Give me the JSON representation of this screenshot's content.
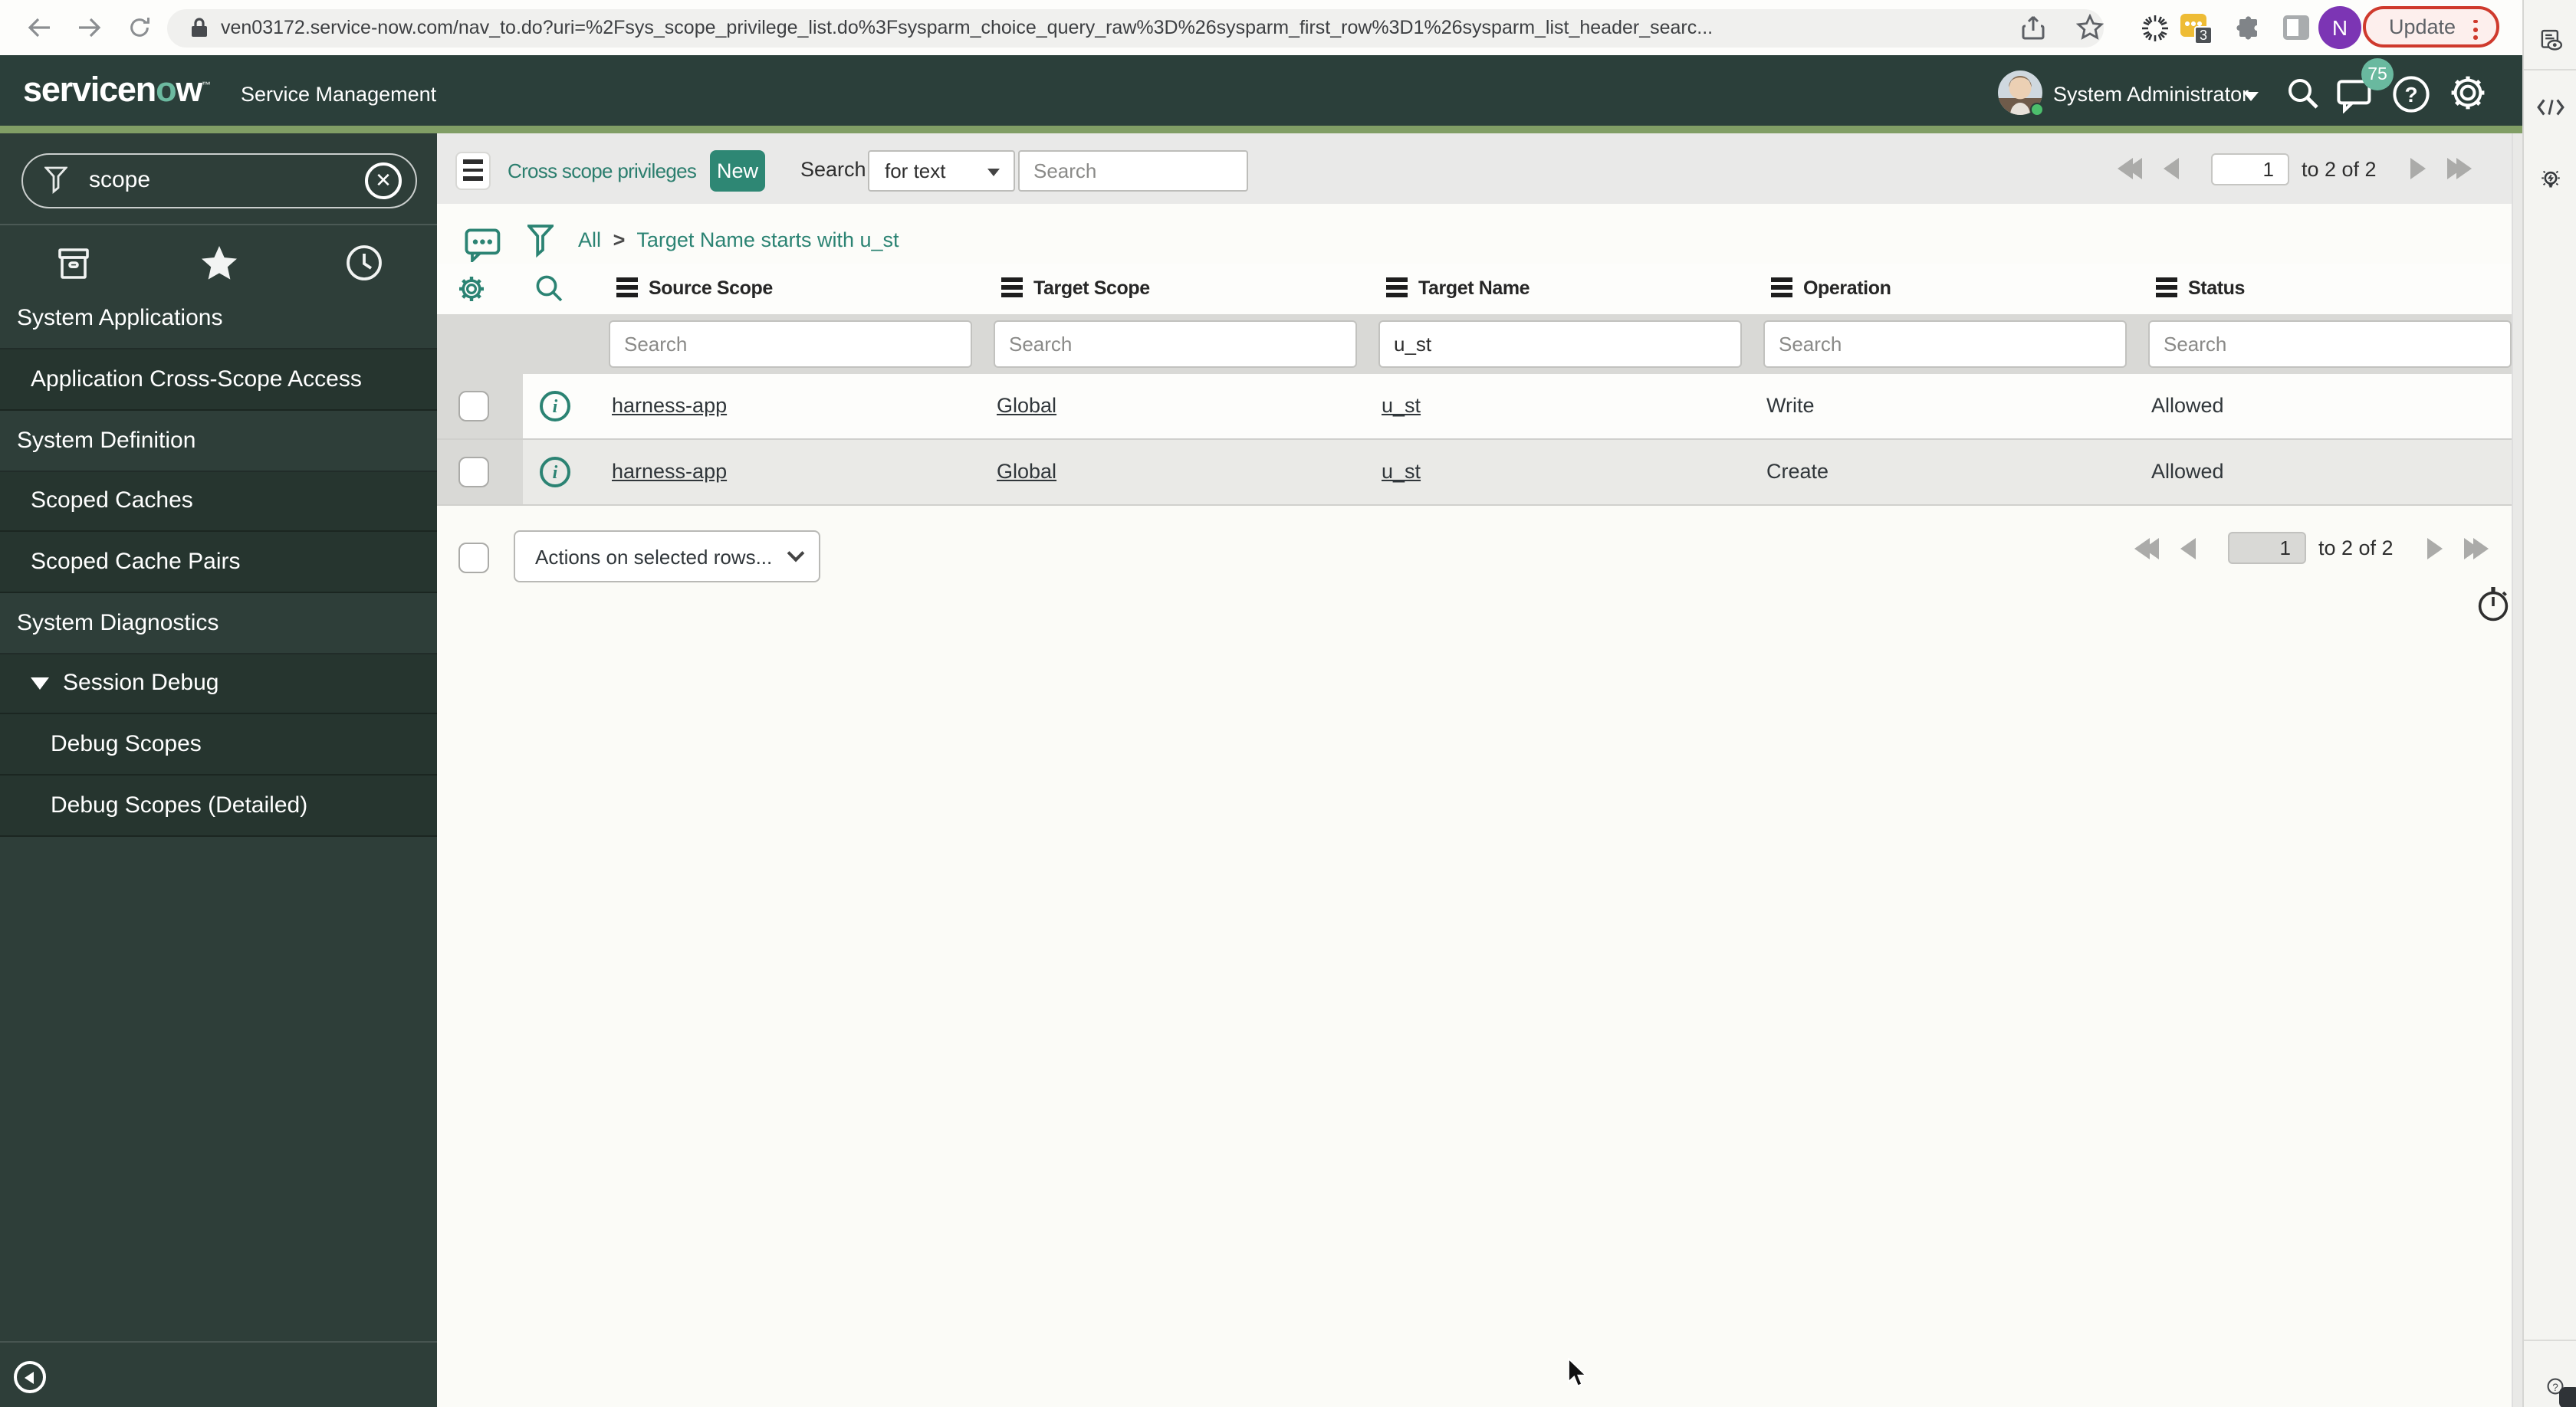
{
  "browser": {
    "url": "ven03172.service-now.com/nav_to.do?uri=%2Fsys_scope_privilege_list.do%3Fsysparm_choice_query_raw%3D%26sysparm_first_row%3D1%26sysparm_list_header_searc...",
    "update_label": "Update",
    "profile_initial": "N",
    "extension_badge": "3"
  },
  "snow_header": {
    "logo_pre": "servicen",
    "logo_o": "o",
    "logo_post": "w",
    "product": "Service Management",
    "user": "System Administrator",
    "chat_badge": "75"
  },
  "sidebar": {
    "filter_value": "scope",
    "items": [
      {
        "label": "System Applications",
        "type": "section",
        "indent": 0
      },
      {
        "label": "Application Cross-Scope Access",
        "type": "item",
        "indent": 1
      },
      {
        "label": "System Definition",
        "type": "section",
        "indent": 0
      },
      {
        "label": "Scoped Caches",
        "type": "item",
        "indent": 1
      },
      {
        "label": "Scoped Cache Pairs",
        "type": "item",
        "indent": 1
      },
      {
        "label": "System Diagnostics",
        "type": "section",
        "indent": 0
      },
      {
        "label": "Session Debug",
        "type": "item",
        "indent": 1,
        "expanded": true
      },
      {
        "label": "Debug Scopes",
        "type": "item",
        "indent": 2
      },
      {
        "label": "Debug Scopes (Detailed)",
        "type": "item",
        "indent": 2
      }
    ]
  },
  "toolbar": {
    "title": "Cross scope privileges",
    "new_label": "New",
    "search_label": "Search",
    "search_type": "for text",
    "search_placeholder": "Search"
  },
  "breadcrumb": {
    "all": "All",
    "sep": ">",
    "filter": "Target Name starts with u_st"
  },
  "table": {
    "columns": [
      "Source Scope",
      "Target Scope",
      "Target Name",
      "Operation",
      "Status"
    ],
    "filters": [
      {
        "placeholder": "Search",
        "value": ""
      },
      {
        "placeholder": "Search",
        "value": ""
      },
      {
        "placeholder": "",
        "value": "u_st"
      },
      {
        "placeholder": "Search",
        "value": ""
      },
      {
        "placeholder": "Search",
        "value": ""
      }
    ],
    "rows": [
      [
        "harness-app",
        "Global",
        "u_st",
        "Write",
        "Allowed"
      ],
      [
        "harness-app",
        "Global",
        "u_st",
        "Create",
        "Allowed"
      ]
    ]
  },
  "footer": {
    "actions_label": "Actions on selected rows..."
  },
  "pagination": {
    "page": "1",
    "range_label": "to 2 of 2"
  }
}
